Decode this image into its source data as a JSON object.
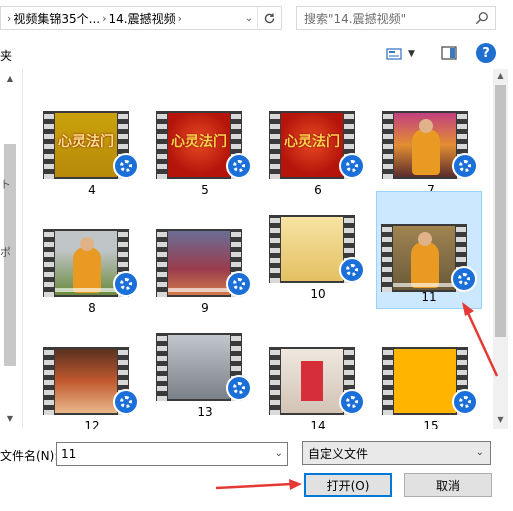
{
  "address_bar": {
    "crumbs": [
      "视频集锦35个...",
      "14.震撼视频"
    ]
  },
  "search": {
    "placeholder": "搜索\"14.震撼视频\""
  },
  "toolbar": {
    "left_text": "夹"
  },
  "left_panel": {
    "glyph1": "ト",
    "glyph2": "ポ"
  },
  "files": [
    {
      "label": "4",
      "thumb": "gold-title",
      "title_text": "心灵法门"
    },
    {
      "label": "5",
      "thumb": "red-title",
      "title_text": "心灵法门"
    },
    {
      "label": "6",
      "thumb": "red-title",
      "title_text": "心灵法门"
    },
    {
      "label": "7",
      "thumb": "stage"
    },
    {
      "label": "8",
      "thumb": "man"
    },
    {
      "label": "9",
      "thumb": "crowd"
    },
    {
      "label": "10",
      "thumb": "temple"
    },
    {
      "label": "11",
      "thumb": "painting",
      "selected": true
    },
    {
      "label": "12",
      "thumb": "crowd2"
    },
    {
      "label": "13",
      "thumb": "building"
    },
    {
      "label": "14",
      "thumb": "book"
    },
    {
      "label": "15",
      "thumb": "orange"
    }
  ],
  "filename": {
    "label": "文件名(N):",
    "value": "11"
  },
  "filetype": {
    "value": "自定义文件"
  },
  "buttons": {
    "open": "打开(O)",
    "cancel": "取消"
  },
  "colors": {
    "selection": "#cce8ff",
    "accent": "#0078d7",
    "arrow": "#e53935"
  }
}
